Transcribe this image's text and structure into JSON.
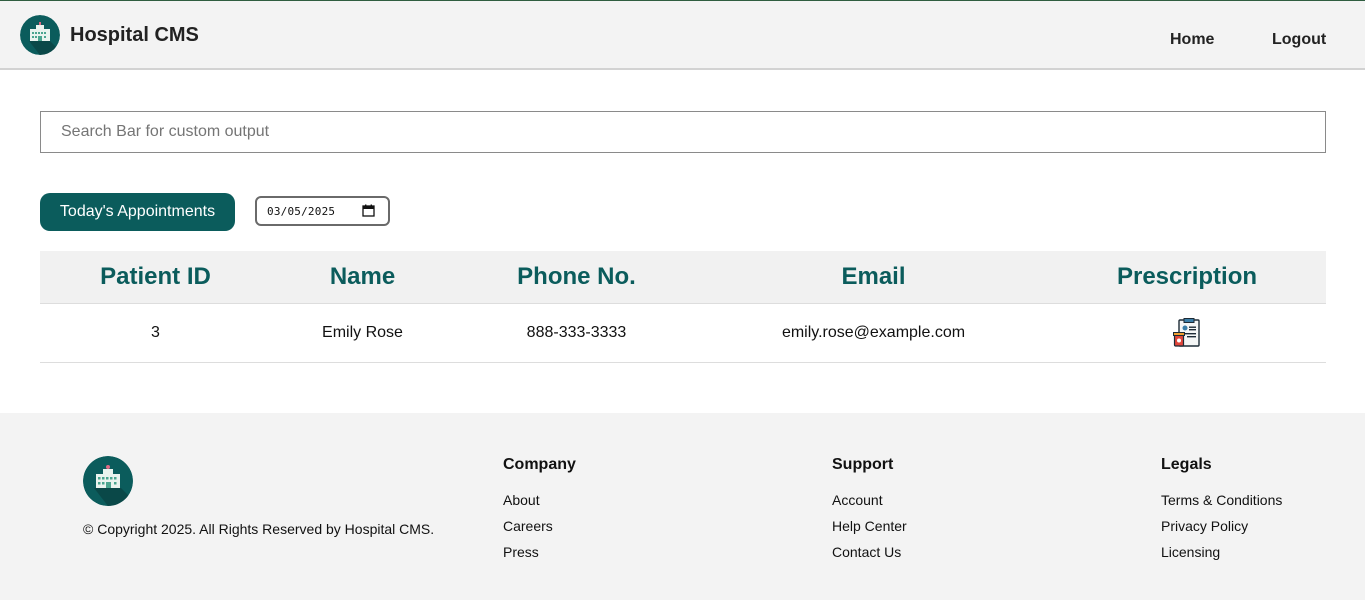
{
  "header": {
    "brand_title": "Hospital CMS",
    "nav": {
      "home": "Home",
      "logout": "Logout"
    }
  },
  "search": {
    "placeholder": "Search Bar for custom output",
    "value": ""
  },
  "controls": {
    "appointments_button": "Today's Appointments",
    "date_value": "03/05/2025"
  },
  "table": {
    "headers": {
      "id": "Patient ID",
      "name": "Name",
      "phone": "Phone No.",
      "email": "Email",
      "prescription": "Prescription"
    },
    "rows": [
      {
        "id": "3",
        "name": "Emily Rose",
        "phone": "888-333-3333",
        "email": "emily.rose@example.com",
        "prescription_icon": "prescription-icon"
      }
    ]
  },
  "footer": {
    "copyright": "© Copyright 2025. All Rights Reserved by Hospital CMS.",
    "columns": [
      {
        "title": "Company",
        "links": [
          "About",
          "Careers",
          "Press"
        ]
      },
      {
        "title": "Support",
        "links": [
          "Account",
          "Help Center",
          "Contact Us"
        ]
      },
      {
        "title": "Legals",
        "links": [
          "Terms & Conditions",
          "Privacy Policy",
          "Licensing"
        ]
      }
    ]
  },
  "colors": {
    "accent": "#0b5c5c",
    "header_bg": "#f3f3f3",
    "footer_bg": "#f3f3f3"
  },
  "icons": {
    "logo": "hospital-logo-icon",
    "calendar": "calendar-icon",
    "prescription": "prescription-icon"
  }
}
